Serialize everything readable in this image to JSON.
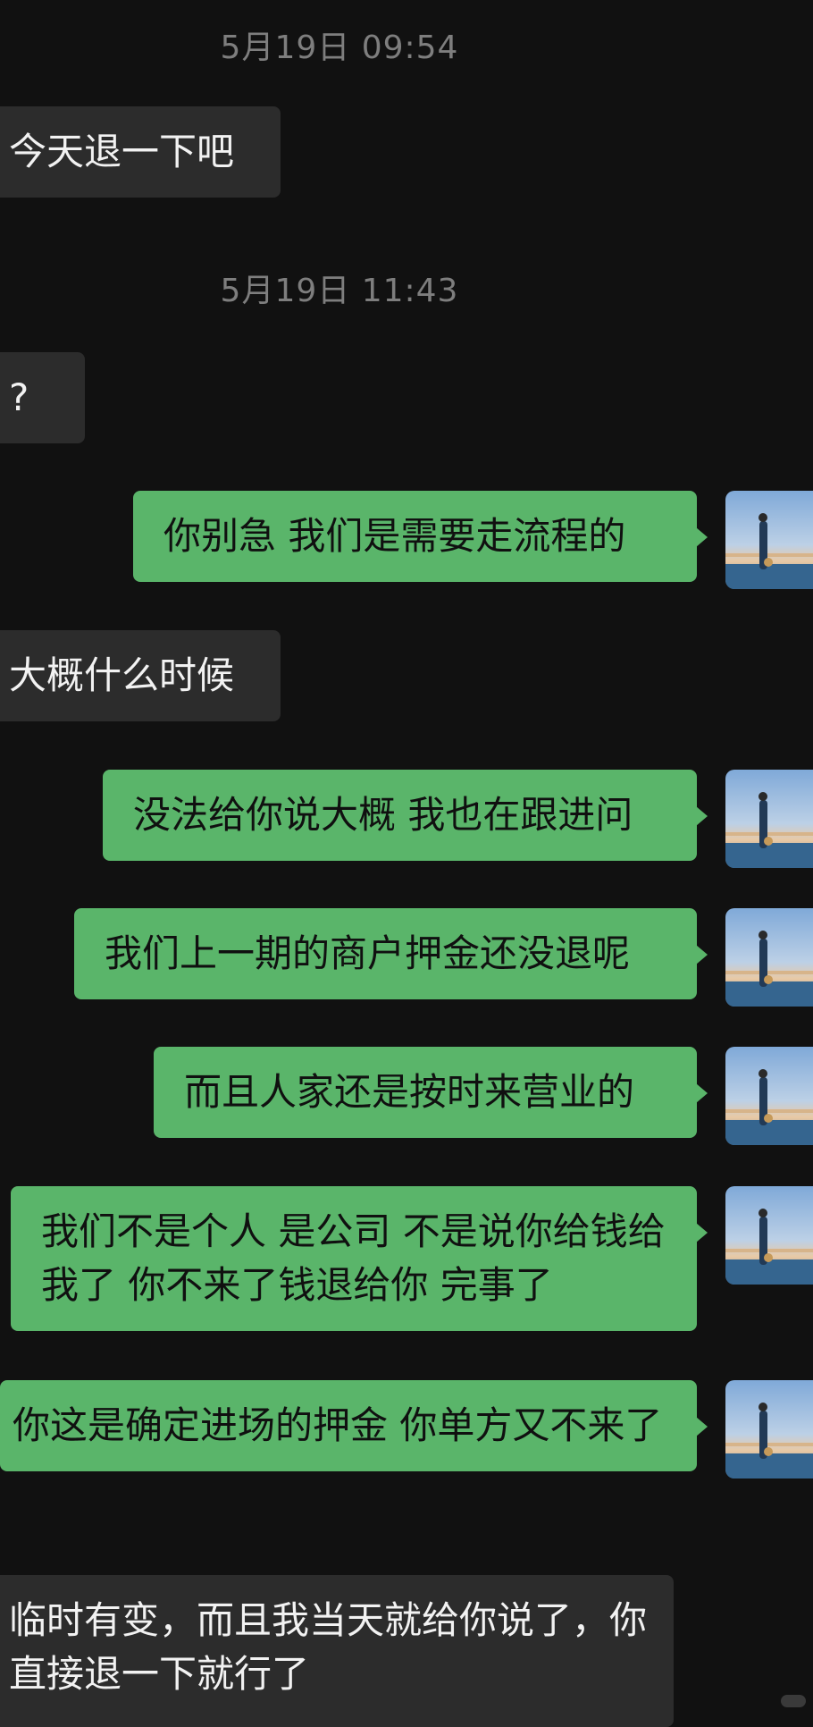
{
  "chat": {
    "timestamps": [
      "5月19日 09:54",
      "5月19日 11:43"
    ],
    "messages": [
      {
        "side": "in",
        "text": "今天退一下吧"
      },
      {
        "side": "in",
        "text": "?"
      },
      {
        "side": "out",
        "text": "你别急 我们是需要走流程的"
      },
      {
        "side": "in",
        "text": "大概什么时候"
      },
      {
        "side": "out",
        "text": "没法给你说大概 我也在跟进问"
      },
      {
        "side": "out",
        "text": "我们上一期的商户押金还没退呢"
      },
      {
        "side": "out",
        "text": "而且人家还是按时来营业的"
      },
      {
        "side": "out",
        "text": "我们不是个人 是公司 不是说你给钱给我了 你不来了钱退给你 完事了"
      },
      {
        "side": "out",
        "text": "你这是确定进场的押金 你单方又不来了"
      },
      {
        "side": "in",
        "text": "临时有变，而且我当天就给你说了，你直接退一下就行了"
      }
    ]
  },
  "avatar": {
    "icon": "user-avatar-photo"
  },
  "colors": {
    "background": "#111111",
    "incoming_bubble": "#2c2c2c",
    "outgoing_bubble": "#5ab56a",
    "timestamp": "#7e7e7e"
  }
}
